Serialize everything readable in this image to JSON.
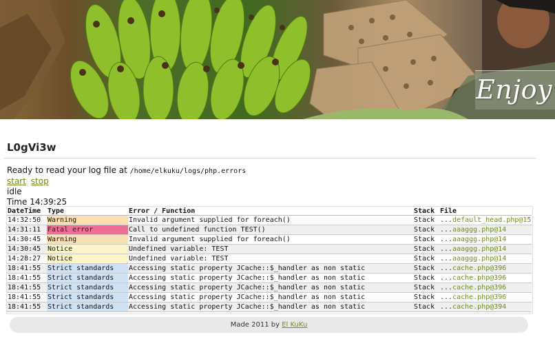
{
  "banner": {
    "text": "Enjoy"
  },
  "app": {
    "title": "L0gVi3w"
  },
  "intro": {
    "text": "Ready to read your log file at",
    "path": "/home/elkuku/logs/php.errors"
  },
  "controls": {
    "start_label": "start",
    "stop_label": "stop"
  },
  "status": {
    "state": "idle",
    "time_label": "Time",
    "time_value": "14:39:25"
  },
  "table": {
    "headers": [
      "DateTime",
      "Type",
      "Error / Function",
      "Stack",
      "File"
    ],
    "rows": [
      {
        "time": "14:32:50",
        "type": "Warning",
        "type_class": "Warning",
        "message": "Invalid argument supplied for foreach()",
        "stack": "Stack",
        "dots": "...",
        "file": "default_head.php@15"
      },
      {
        "time": "14:31:11",
        "type": "Fatal error",
        "type_class": "Fatal",
        "message": "Call to undefined function TEST()",
        "stack": "Stack",
        "dots": "...",
        "file": "aaaggg.php@14"
      },
      {
        "time": "14:30:45",
        "type": "Warning",
        "type_class": "Warning",
        "message": "Invalid argument supplied for foreach()",
        "stack": "Stack",
        "dots": "...",
        "file": "aaaggg.php@14"
      },
      {
        "time": "14:30:45",
        "type": "Notice",
        "type_class": "Notice",
        "message": "Undefined variable: TEST",
        "stack": "Stack",
        "dots": "...",
        "file": "aaaggg.php@14"
      },
      {
        "time": "14:28:27",
        "type": "Notice",
        "type_class": "Notice",
        "message": "Undefined variable: TEST",
        "stack": "Stack",
        "dots": "...",
        "file": "aaaggg.php@14"
      },
      {
        "time": "18:41:55",
        "type": "Strict standards",
        "type_class": "Strict",
        "message": "Accessing static property JCache::$_handler as non static",
        "stack": "Stack",
        "dots": "...",
        "file": "cache.php@396"
      },
      {
        "time": "18:41:55",
        "type": "Strict standards",
        "type_class": "Strict",
        "message": "Accessing static property JCache::$_handler as non static",
        "stack": "Stack",
        "dots": "...",
        "file": "cache.php@396"
      },
      {
        "time": "18:41:55",
        "type": "Strict standards",
        "type_class": "Strict",
        "message": "Accessing static property JCache::$_handler as non static",
        "stack": "Stack",
        "dots": "...",
        "file": "cache.php@396"
      },
      {
        "time": "18:41:55",
        "type": "Strict standards",
        "type_class": "Strict",
        "message": "Accessing static property JCache::$_handler as non static",
        "stack": "Stack",
        "dots": "...",
        "file": "cache.php@396"
      },
      {
        "time": "18:41:55",
        "type": "Strict standards",
        "type_class": "Strict",
        "message": "Accessing static property JCache::$_handler as non static",
        "stack": "Stack",
        "dots": "...",
        "file": "cache.php@394"
      }
    ]
  },
  "footer": {
    "made_text": "Made 2011 by",
    "author_link": "El KuKu"
  },
  "colors": {
    "accent_link": "#6d8d15",
    "warning": "#fbdfb0",
    "fatal": "#f06e94",
    "notice": "#fcf6c6",
    "strict": "#cfe2f5"
  }
}
